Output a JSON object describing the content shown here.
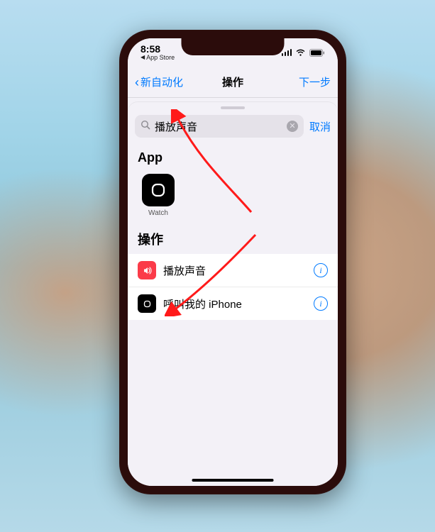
{
  "status_bar": {
    "time": "8:58",
    "breadcrumb": "App Store"
  },
  "nav": {
    "back_label": "新自动化",
    "title": "操作",
    "next_label": "下一步"
  },
  "search": {
    "query": "播放声音",
    "cancel_label": "取消"
  },
  "sections": {
    "apps_header": "App",
    "actions_header": "操作"
  },
  "apps": [
    {
      "label": "Watch"
    }
  ],
  "actions": [
    {
      "label": "播放声音",
      "icon": "volume",
      "color": "red"
    },
    {
      "label": "呼叫我的 iPhone",
      "icon": "watch",
      "color": "black"
    }
  ],
  "colors": {
    "accent": "#007aff",
    "danger": "#fb3b49"
  }
}
